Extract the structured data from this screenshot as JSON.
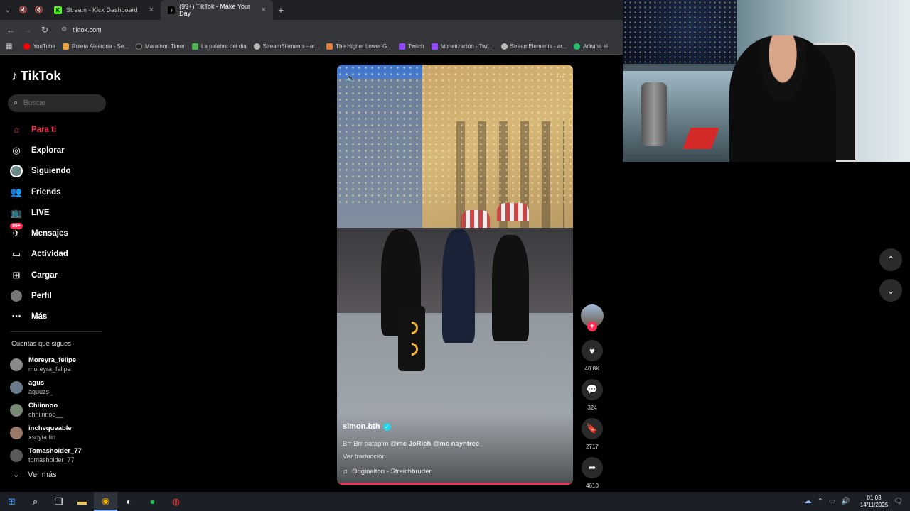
{
  "browser": {
    "tabs": [
      {
        "title": "Stream - Kick Dashboard",
        "favicon_color": "#53fc18",
        "favicon_letter": "K",
        "active": false
      },
      {
        "title": "(99+) TikTok - Make Your Day",
        "favicon_color": "#000000",
        "favicon_letter": "♪",
        "active": true
      }
    ],
    "new_tab": "+",
    "url": "tiktok.com",
    "bookmarks": [
      {
        "label": "YouTube",
        "color": "#ff0000"
      },
      {
        "label": "Ruleta Aleatoria - Se...",
        "color": "#e6a23c"
      },
      {
        "label": "Marathon Timer",
        "color": "#222222"
      },
      {
        "label": "La palabra del dia",
        "color": "#4caf50"
      },
      {
        "label": "StreamElements - ar...",
        "color": "#bbbbbb"
      },
      {
        "label": "The Higher Lower G...",
        "color": "#e07b3b"
      },
      {
        "label": "Twitch",
        "color": "#9146ff"
      },
      {
        "label": "Monetización - Twit...",
        "color": "#9146ff"
      },
      {
        "label": "StreamElements - ar...",
        "color": "#bbbbbb"
      },
      {
        "label": "Adivina el",
        "color": "#20c06a"
      }
    ]
  },
  "tiktok": {
    "logo": "TikTok",
    "search_placeholder": "Buscar",
    "nav": [
      {
        "label": "Para ti",
        "icon": "home-icon",
        "active": true
      },
      {
        "label": "Explorar",
        "icon": "compass-icon"
      },
      {
        "label": "Siguiendo",
        "icon": "following-avatar-icon"
      },
      {
        "label": "Friends",
        "icon": "friends-icon"
      },
      {
        "label": "LIVE",
        "icon": "live-icon"
      },
      {
        "label": "Mensajes",
        "icon": "messages-icon",
        "badge": "99+"
      },
      {
        "label": "Actividad",
        "icon": "activity-icon"
      },
      {
        "label": "Cargar",
        "icon": "upload-icon"
      },
      {
        "label": "Perfil",
        "icon": "profile-icon"
      },
      {
        "label": "Más",
        "icon": "more-icon"
      }
    ],
    "following_title": "Cuentas que sigues",
    "following": [
      {
        "name": "Moreyra_felipe",
        "handle": "moreyra_felipe"
      },
      {
        "name": "agus",
        "handle": "aguuzs_"
      },
      {
        "name": "Chiinnoo",
        "handle": "chhiinnoo__"
      },
      {
        "name": "inchequeable",
        "handle": "xsoyta tin"
      },
      {
        "name": "Tomasholder_77",
        "handle": "tomasholder_77"
      }
    ],
    "see_more": "Ver más",
    "video": {
      "author": "simon.bth",
      "caption_text": "Brr Brr patapim ",
      "caption_mentions": "@mc JoRich @mc nayntree_",
      "translate": "Ver traducción",
      "sound": "Originalton - Streichbruder",
      "progress": 1.0
    },
    "actions": {
      "likes": "40.8K",
      "comments": "324",
      "saves": "2717",
      "shares": "4610"
    }
  },
  "taskbar": {
    "time": "01:03",
    "date": "14/11/2025"
  }
}
